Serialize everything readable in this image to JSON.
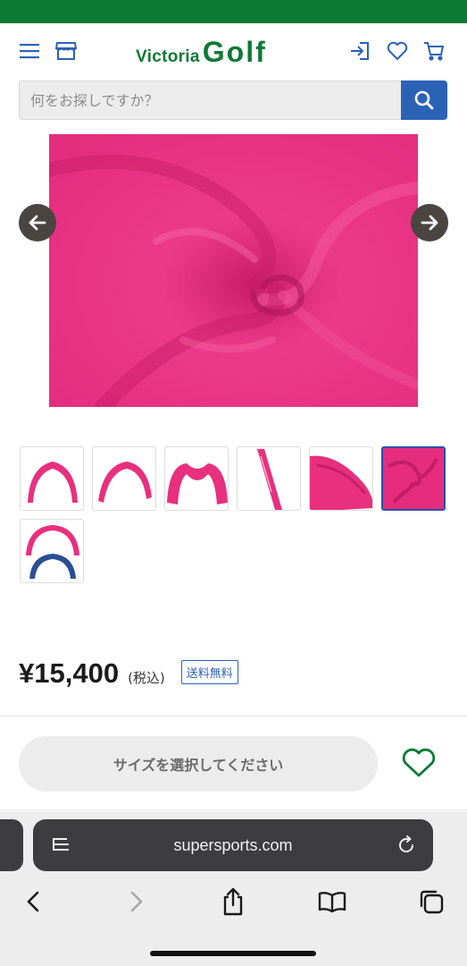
{
  "header": {
    "logo_part1": "Victoria",
    "logo_part2": "Golf",
    "brand_color": "#0c7a35",
    "icons": [
      "menu-icon",
      "store-icon",
      "login-icon",
      "heart-icon",
      "cart-icon"
    ]
  },
  "search": {
    "placeholder": "何をお探しですか？",
    "value": "",
    "button_color": "#2c62b6"
  },
  "gallery": {
    "selected_index": 5,
    "thumbnail_count": 7
  },
  "product": {
    "price": "¥15,400",
    "tax_note": "(税込)",
    "shipping_badge": "送料無料",
    "color": "#e62c7f"
  },
  "actions": {
    "size_select_label": "サイズを選択してください"
  },
  "browser": {
    "url": "supersports.com"
  }
}
